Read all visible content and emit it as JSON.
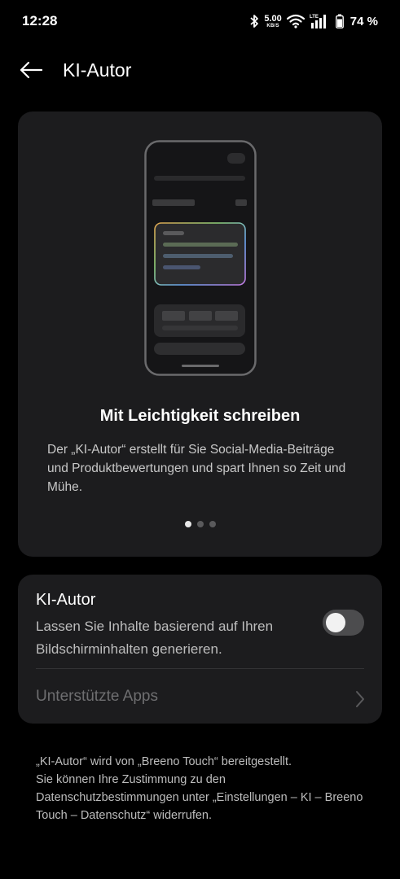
{
  "status_bar": {
    "time": "12:28",
    "net_speed_value": "5.00",
    "net_speed_unit": "KB/S",
    "network_type": "LTE",
    "battery_percent": "74 %",
    "icons": [
      "bluetooth-icon",
      "wifi-icon",
      "signal-icon",
      "battery-icon"
    ]
  },
  "app_bar": {
    "title": "KI-Autor",
    "back_icon": "arrow-left-icon"
  },
  "hero": {
    "title": "Mit Leichtigkeit schreiben",
    "description": "Der „KI-Autor“ erstellt für Sie Social-Media-Beiträge und Produktbewertungen und spart Ihnen so Zeit und Mühe.",
    "page_indicator": {
      "current": 1,
      "total": 3
    }
  },
  "setting": {
    "title": "KI-Autor",
    "description": "Lassen Sie Inhalte basierend auf Ihren Bildschirminhalten generieren.",
    "enabled": false,
    "supported_apps_label": "Unterstützte Apps"
  },
  "footer": {
    "line1": "„KI-Autor“ wird von „Breeno Touch“ bereitgestellt.",
    "line2": "Sie können Ihre Zustimmung zu den Datenschutzbestimmungen unter „Einstellungen – KI – Breeno Touch – Datenschutz“ widerrufen."
  },
  "colors": {
    "background": "#000000",
    "card": "#1c1c1e",
    "toggle_off": "#4c4c4e",
    "disabled_text": "#6e6e70"
  }
}
